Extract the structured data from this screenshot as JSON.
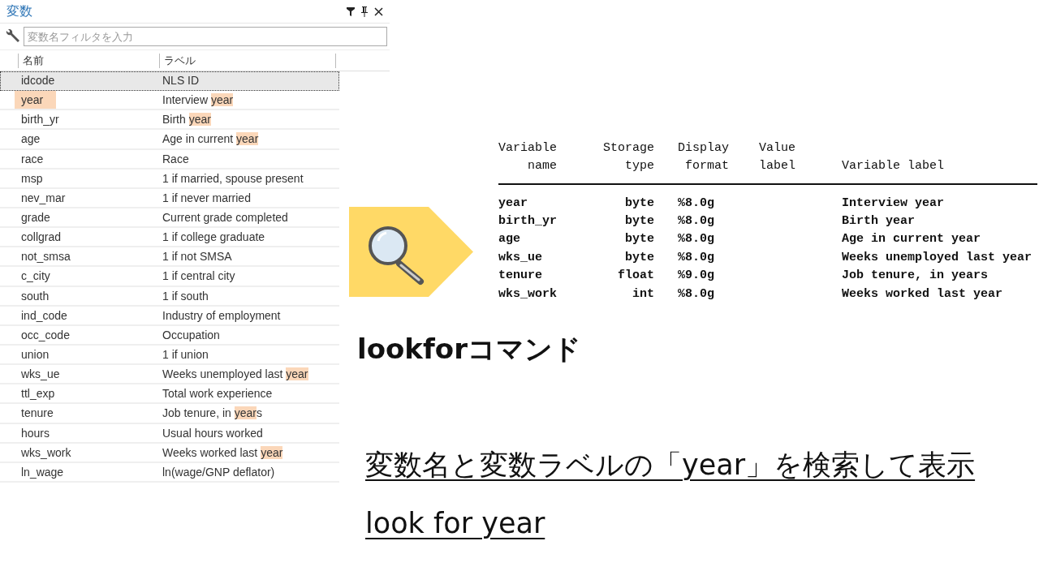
{
  "panel": {
    "title": "変数",
    "filter": {
      "placeholder": "変数名フィルタを入力"
    },
    "columns": [
      "名前",
      "ラベル"
    ],
    "variables": [
      {
        "name": "idcode",
        "name_hit": false,
        "selected": true,
        "label_parts": [
          {
            "text": "NLS ID",
            "hit": false
          }
        ]
      },
      {
        "name": "year",
        "name_hit": true,
        "selected": false,
        "label_parts": [
          {
            "text": "Interview ",
            "hit": false
          },
          {
            "text": "year",
            "hit": true
          }
        ]
      },
      {
        "name": "birth_yr",
        "name_hit": false,
        "selected": false,
        "label_parts": [
          {
            "text": "Birth ",
            "hit": false
          },
          {
            "text": "year",
            "hit": true
          }
        ]
      },
      {
        "name": "age",
        "name_hit": false,
        "selected": false,
        "label_parts": [
          {
            "text": "Age in current ",
            "hit": false
          },
          {
            "text": "year",
            "hit": true
          }
        ]
      },
      {
        "name": "race",
        "name_hit": false,
        "selected": false,
        "label_parts": [
          {
            "text": "Race",
            "hit": false
          }
        ]
      },
      {
        "name": "msp",
        "name_hit": false,
        "selected": false,
        "label_parts": [
          {
            "text": "1 if married, spouse present",
            "hit": false
          }
        ]
      },
      {
        "name": "nev_mar",
        "name_hit": false,
        "selected": false,
        "label_parts": [
          {
            "text": "1 if never married",
            "hit": false
          }
        ]
      },
      {
        "name": "grade",
        "name_hit": false,
        "selected": false,
        "label_parts": [
          {
            "text": "Current grade completed",
            "hit": false
          }
        ]
      },
      {
        "name": "collgrad",
        "name_hit": false,
        "selected": false,
        "label_parts": [
          {
            "text": "1 if college graduate",
            "hit": false
          }
        ]
      },
      {
        "name": "not_smsa",
        "name_hit": false,
        "selected": false,
        "label_parts": [
          {
            "text": "1 if not SMSA",
            "hit": false
          }
        ]
      },
      {
        "name": "c_city",
        "name_hit": false,
        "selected": false,
        "label_parts": [
          {
            "text": "1 if central city",
            "hit": false
          }
        ]
      },
      {
        "name": "south",
        "name_hit": false,
        "selected": false,
        "label_parts": [
          {
            "text": "1 if south",
            "hit": false
          }
        ]
      },
      {
        "name": "ind_code",
        "name_hit": false,
        "selected": false,
        "label_parts": [
          {
            "text": "Industry of employment",
            "hit": false
          }
        ]
      },
      {
        "name": "occ_code",
        "name_hit": false,
        "selected": false,
        "label_parts": [
          {
            "text": "Occupation",
            "hit": false
          }
        ]
      },
      {
        "name": "union",
        "name_hit": false,
        "selected": false,
        "label_parts": [
          {
            "text": "1 if union",
            "hit": false
          }
        ]
      },
      {
        "name": "wks_ue",
        "name_hit": false,
        "selected": false,
        "label_parts": [
          {
            "text": "Weeks unemployed last ",
            "hit": false
          },
          {
            "text": "year",
            "hit": true
          }
        ]
      },
      {
        "name": "ttl_exp",
        "name_hit": false,
        "selected": false,
        "label_parts": [
          {
            "text": "Total work experience",
            "hit": false
          }
        ]
      },
      {
        "name": "tenure",
        "name_hit": false,
        "selected": false,
        "label_parts": [
          {
            "text": "Job tenure, in ",
            "hit": false
          },
          {
            "text": "year",
            "hit": true
          },
          {
            "text": "s",
            "hit": false
          }
        ]
      },
      {
        "name": "hours",
        "name_hit": false,
        "selected": false,
        "label_parts": [
          {
            "text": "Usual hours worked",
            "hit": false
          }
        ]
      },
      {
        "name": "wks_work",
        "name_hit": false,
        "selected": false,
        "label_parts": [
          {
            "text": "Weeks worked last ",
            "hit": false
          },
          {
            "text": "year",
            "hit": true
          }
        ]
      },
      {
        "name": "ln_wage",
        "name_hit": false,
        "selected": false,
        "label_parts": [
          {
            "text": "ln(wage/GNP deflator)",
            "hit": false
          }
        ]
      }
    ]
  },
  "output": {
    "columns": [
      {
        "line1": "Variable",
        "line2": "name"
      },
      {
        "line1": "Storage",
        "line2": "type"
      },
      {
        "line1": "Display",
        "line2": "format"
      },
      {
        "line1": "Value",
        "line2": "label"
      },
      {
        "line2": "Variable label"
      }
    ],
    "rows": [
      {
        "name": "year",
        "type": "byte",
        "format": "%8.0g",
        "label": "Interview year"
      },
      {
        "name": "birth_yr",
        "type": "byte",
        "format": "%8.0g",
        "label": "Birth year"
      },
      {
        "name": "age",
        "type": "byte",
        "format": "%8.0g",
        "label": "Age in current year"
      },
      {
        "name": "wks_ue",
        "type": "byte",
        "format": "%8.0g",
        "label": "Weeks unemployed last year"
      },
      {
        "name": "tenure",
        "type": "float",
        "format": "%9.0g",
        "label": "Job tenure, in years"
      },
      {
        "name": "wks_work",
        "type": "int",
        "format": "%8.0g",
        "label": "Weeks worked last year"
      }
    ]
  },
  "heading": "lookforコマンド",
  "captions": [
    "変数名と変数ラベルの「year」を検索して表示",
    "look for year"
  ]
}
